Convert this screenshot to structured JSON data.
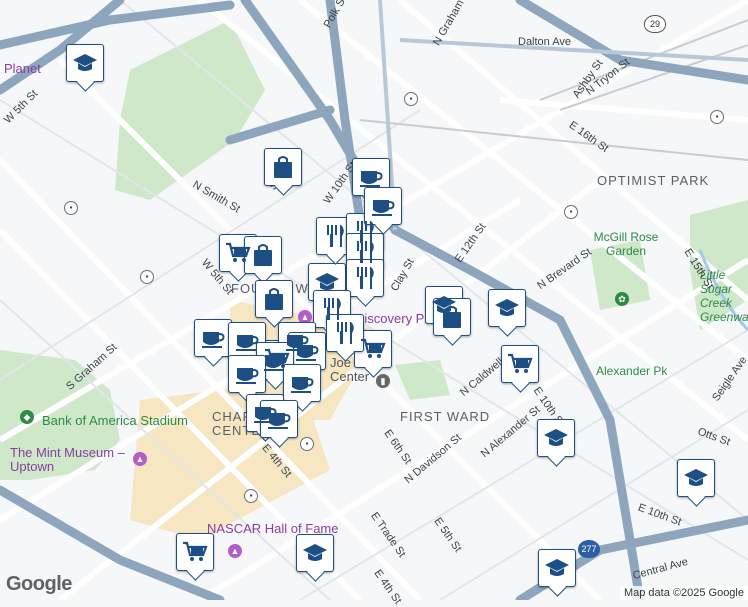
{
  "labels": {
    "neighborhoods": [
      "OPTIMIST PARK",
      "FIRST WARD",
      "CHARLOTTE CENTER",
      "FOURTH WARD"
    ],
    "parks": [
      "McGill Rose Garden",
      "Alexander Pk",
      "Little Sugar Creek Greenway"
    ],
    "pois": [
      "Bank of America Stadium",
      "The Mint Museum – Uptown",
      "NASCAR Hall of Fame",
      "Discovery Place",
      "Joe Martin Center",
      "Planet"
    ],
    "streets": [
      "Dalton Ave",
      "Ashby St",
      "N Tryon St",
      "N Graham St",
      "Polk St",
      "E 16th St",
      "E 12th St",
      "N Brevard St",
      "E 15th St",
      "Seigle Ave",
      "E 10th St",
      "Otts St",
      "Central Ave",
      "E 10th St",
      "N Alexander St",
      "N Caldwell St",
      "N Davidson St",
      "E 6th St",
      "E 5th St",
      "E Trade St",
      "E 4th St",
      "S Graham St",
      "W 5th St",
      "W 10th St",
      "N Smith St",
      "E 4th St",
      "W 5th St",
      "Clay St",
      "St"
    ],
    "route_shields": [
      "29",
      "277"
    ]
  },
  "attribution": {
    "google": "Google",
    "map_data": "Map data ©2025 Google"
  },
  "markers": {
    "education": [
      "school",
      "school",
      "school",
      "school",
      "school",
      "school",
      "school",
      "school"
    ],
    "grocery": [
      "grocery",
      "grocery",
      "grocery",
      "grocery",
      "grocery"
    ],
    "shopping": [
      "shopping",
      "shopping",
      "shopping",
      "shopping"
    ],
    "restaurant": [
      "restaurant",
      "restaurant",
      "restaurant",
      "restaurant",
      "restaurant",
      "restaurant"
    ],
    "cafe": [
      "cafe",
      "cafe",
      "cafe",
      "cafe",
      "cafe",
      "cafe",
      "cafe",
      "cafe",
      "cafe",
      "cafe",
      "cafe"
    ]
  },
  "colors": {
    "marker_border": "#1e4f84",
    "marker_icon": "#1e4f84",
    "highway": "#9fb3c8",
    "park": "#cfe8c9",
    "downtown": "#f6e6c2"
  }
}
